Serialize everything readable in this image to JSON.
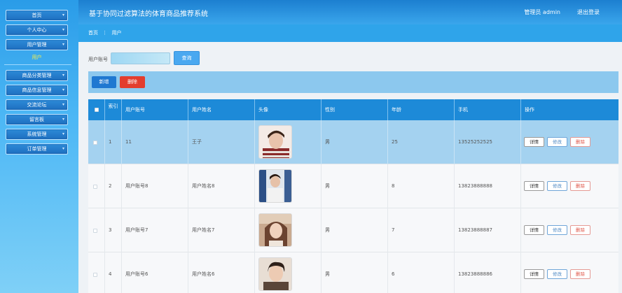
{
  "header": {
    "title": "基于协同过滤算法的体育商品推荐系统",
    "user": "管理员 admin",
    "logout": "退出登录"
  },
  "sidebar": {
    "items": [
      {
        "label": "首页"
      },
      {
        "label": "个人中心"
      },
      {
        "label": "用户管理"
      },
      {
        "label": "商品分类管理"
      },
      {
        "label": "商品信息管理"
      },
      {
        "label": "交流论坛"
      },
      {
        "label": "留言板"
      },
      {
        "label": "系统管理"
      },
      {
        "label": "订单管理"
      }
    ],
    "sub_item": "用户"
  },
  "breadcrumb": {
    "home": "首页",
    "sep": "⋮",
    "current": "用户"
  },
  "search": {
    "label": "用户账号",
    "placeholder": "",
    "button": "查询"
  },
  "toolbar": {
    "add": "新增",
    "delete": "删除"
  },
  "table": {
    "headers": {
      "index": "索引",
      "account": "用户账号",
      "name": "用户姓名",
      "avatar": "头像",
      "gender": "性别",
      "age": "年龄",
      "phone": "手机",
      "actions": "操作"
    },
    "actions": {
      "view": "详情",
      "edit": "修改",
      "remove": "删除"
    },
    "rows": [
      {
        "index": "1",
        "account": "11",
        "name": "王子",
        "gender": "男",
        "age": "25",
        "phone": "13525252525"
      },
      {
        "index": "2",
        "account": "用户账号8",
        "name": "用户姓名8",
        "gender": "男",
        "age": "8",
        "phone": "13823888888"
      },
      {
        "index": "3",
        "account": "用户账号7",
        "name": "用户姓名7",
        "gender": "男",
        "age": "7",
        "phone": "13823888887"
      },
      {
        "index": "4",
        "account": "用户账号6",
        "name": "用户姓名6",
        "gender": "男",
        "age": "6",
        "phone": "13823888886"
      }
    ]
  }
}
